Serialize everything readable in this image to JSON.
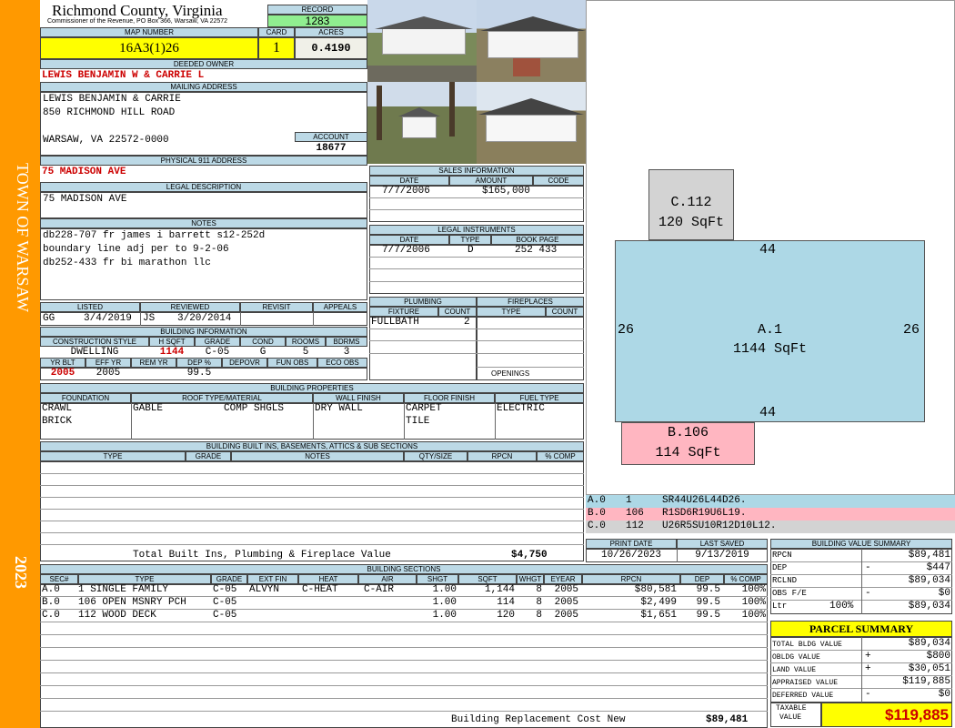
{
  "sidebar": {
    "town": "TOWN OF WARSAW",
    "year": "2023",
    "color": "#ff9900"
  },
  "header": {
    "county": "Richmond County, Virginia",
    "address": "Commissioner of the Revenue, PO Box 366, Warsaw, VA 22572"
  },
  "record": {
    "label": "RECORD",
    "value": "1283"
  },
  "map": {
    "label": "MAP NUMBER",
    "value": "16A3(1)26"
  },
  "card": {
    "label": "CARD",
    "value": "1"
  },
  "acres": {
    "label": "ACRES",
    "value": "0.4190"
  },
  "owner": {
    "label": "DEEDED OWNER",
    "value": "LEWIS BENJAMIN W & CARRIE L"
  },
  "mailing": {
    "label": "MAILING ADDRESS",
    "line1": "LEWIS BENJAMIN & CARRIE",
    "line2": "850 RICHMOND HILL ROAD",
    "line3": "WARSAW, VA 22572-0000"
  },
  "account": {
    "label": "ACCOUNT",
    "value": "18677"
  },
  "physical": {
    "label": "PHYSICAL 911 ADDRESS",
    "value": "75 MADISON AVE"
  },
  "legal": {
    "label": "LEGAL DESCRIPTION",
    "value": "75 MADISON AVE"
  },
  "notes": {
    "label": "NOTES",
    "lines": [
      "db228-707 fr james i barrett s12-252d",
      "boundary line adj per to 9-2-06",
      "db252-433 fr bi marathon llc"
    ]
  },
  "sales": {
    "label": "SALES INFORMATION",
    "cols": [
      "DATE",
      "AMOUNT",
      "CODE"
    ],
    "row": {
      "date": "7/7/2006",
      "amount": "$165,000",
      "code": ""
    }
  },
  "instruments": {
    "label": "LEGAL INSTRUMENTS",
    "cols": [
      "DATE",
      "TYPE",
      "BOOK PAGE"
    ],
    "row": {
      "date": "7/7/2006",
      "type": "D",
      "book": "252 433"
    }
  },
  "listing": {
    "cols": [
      "LISTED",
      "REVIEWED",
      "REVISIT",
      "APPEALS"
    ],
    "listed_by": "GG",
    "listed_date": "3/4/2019",
    "reviewed_by": "JS",
    "reviewed_date": "3/20/2014"
  },
  "plumbing": {
    "label": "PLUMBING",
    "cols": [
      "FIXTURE",
      "COUNT"
    ],
    "fixture": "FULLBATH",
    "count": "2"
  },
  "fireplaces": {
    "label": "FIREPLACES",
    "cols": [
      "TYPE",
      "COUNT"
    ],
    "openings": "OPENINGS"
  },
  "building_info": {
    "label": "BUILDING INFORMATION",
    "cols1": [
      "CONSTRUCTION STYLE",
      "H SQFT",
      "GRADE",
      "COND",
      "ROOMS",
      "BDRMS"
    ],
    "style": "DWELLING",
    "hsqft": "1144",
    "grade": "C-05",
    "cond": "G",
    "rooms": "5",
    "bdrms": "3",
    "cols2": [
      "YR BLT",
      "EFF YR",
      "REM YR",
      "DEP %",
      "DEPOVR",
      "FUN OBS",
      "ECO OBS"
    ],
    "yrblt": "2005",
    "effyr": "2005",
    "dep": "99.5"
  },
  "properties": {
    "label": "BUILDING PROPERTIES",
    "cols": [
      "FOUNDATION",
      "ROOF TYPE/MATERIAL",
      "WALL FINISH",
      "FLOOR FINISH",
      "FUEL TYPE"
    ],
    "foundation1": "CRAWL",
    "foundation2": "BRICK",
    "roof_type": "GABLE",
    "roof_mat": "COMP SHGLS",
    "wall": "DRY WALL",
    "floor1": "CARPET",
    "floor2": "TILE",
    "fuel": "ELECTRIC"
  },
  "builtins": {
    "label": "BUILDING BUILT INS, BASEMENTS, ATTICS & SUB SECTIONS",
    "cols": [
      "TYPE",
      "GRADE",
      "NOTES",
      "QTY/SIZE",
      "RPCN",
      "% COMP"
    ],
    "total_label": "Total Built Ins, Plumbing & Fireplace Value",
    "total_value": "$4,750"
  },
  "print": {
    "print_label": "PRINT DATE",
    "print_date": "10/26/2023",
    "saved_label": "LAST SAVED",
    "saved_date": "9/13/2019"
  },
  "sections": {
    "label": "BUILDING SECTIONS",
    "cols": [
      "SEC#",
      "TYPE",
      "GRADE",
      "EXT FIN",
      "HEAT",
      "AIR",
      "SHGT",
      "SQFT",
      "WHGT",
      "EYEAR",
      "RPCN",
      "DEP",
      "% COMP"
    ],
    "rows": [
      {
        "sec": "A.0",
        "type": "1 SINGLE FAMILY",
        "grade": "C-05",
        "ext": "ALVYN",
        "heat": "C-HEAT",
        "air": "C-AIR",
        "shgt": "1.00",
        "sqft": "1,144",
        "whgt": "8",
        "eyear": "2005",
        "rpcn": "$80,581",
        "dep": "99.5",
        "comp": "100%"
      },
      {
        "sec": "B.0",
        "type": "106 OPEN MSNRY PCH",
        "grade": "C-05",
        "ext": "",
        "heat": "",
        "air": "",
        "shgt": "1.00",
        "sqft": "114",
        "whgt": "8",
        "eyear": "2005",
        "rpcn": "$2,499",
        "dep": "99.5",
        "comp": "100%"
      },
      {
        "sec": "C.0",
        "type": "112 WOOD DECK",
        "grade": "C-05",
        "ext": "",
        "heat": "",
        "air": "",
        "shgt": "1.00",
        "sqft": "120",
        "whgt": "8",
        "eyear": "2005",
        "rpcn": "$1,651",
        "dep": "99.5",
        "comp": "100%"
      }
    ],
    "replacement_label": "Building Replacement Cost New",
    "replacement_value": "$89,481"
  },
  "sketch": {
    "c_label": "C.112",
    "c_area": "120 SqFt",
    "a_label": "A.1",
    "a_area": "1144 SqFt",
    "b_label": "B.106",
    "b_area": "114 SqFt",
    "dim_top": "44",
    "dim_bottom": "44",
    "dim_left": "26",
    "dim_right": "26",
    "colors": {
      "a": "#add8e6",
      "b": "#ffb6c1",
      "c": "#d3d3d3"
    }
  },
  "legend": [
    {
      "sec": "A.0",
      "code": "1",
      "path": "SR44U26L44D26.",
      "color": "#add8e6"
    },
    {
      "sec": "B.0",
      "code": "106",
      "path": "R1SD6R19U6L19.",
      "color": "#ffb6c1"
    },
    {
      "sec": "C.0",
      "code": "112",
      "path": "U26R5SU10R12D10L12.",
      "color": "#d3d3d3"
    }
  ],
  "value_summary": {
    "label": "BUILDING VALUE SUMMARY",
    "rpcn_label": "RPCN",
    "rpcn": "$89,481",
    "dep_label": "DEP",
    "dep_sign": "-",
    "dep": "$447",
    "rclnd_label": "RCLND",
    "rclnd": "$89,034",
    "obs_label": "OBS F/E",
    "obs_sign": "-",
    "obs": "$0",
    "ltr_label": "Ltr",
    "ltr_pct": "100%",
    "ltr": "$89,034"
  },
  "parcel": {
    "label": "PARCEL SUMMARY",
    "total_bldg_label": "TOTAL BLDG VALUE",
    "total_bldg": "$89,034",
    "obldg_label": "OBLDG VALUE",
    "obldg_sign": "+",
    "obldg": "$800",
    "land_label": "LAND VALUE",
    "land_sign": "+",
    "land": "$30,051",
    "appraised_label": "APPRAISED VALUE",
    "appraised": "$119,885",
    "deferred_label": "DEFERRED VALUE",
    "deferred_sign": "-",
    "deferred": "$0",
    "taxable_label1": "TAXABLE",
    "taxable_label2": "VALUE",
    "taxable": "$119,885"
  }
}
